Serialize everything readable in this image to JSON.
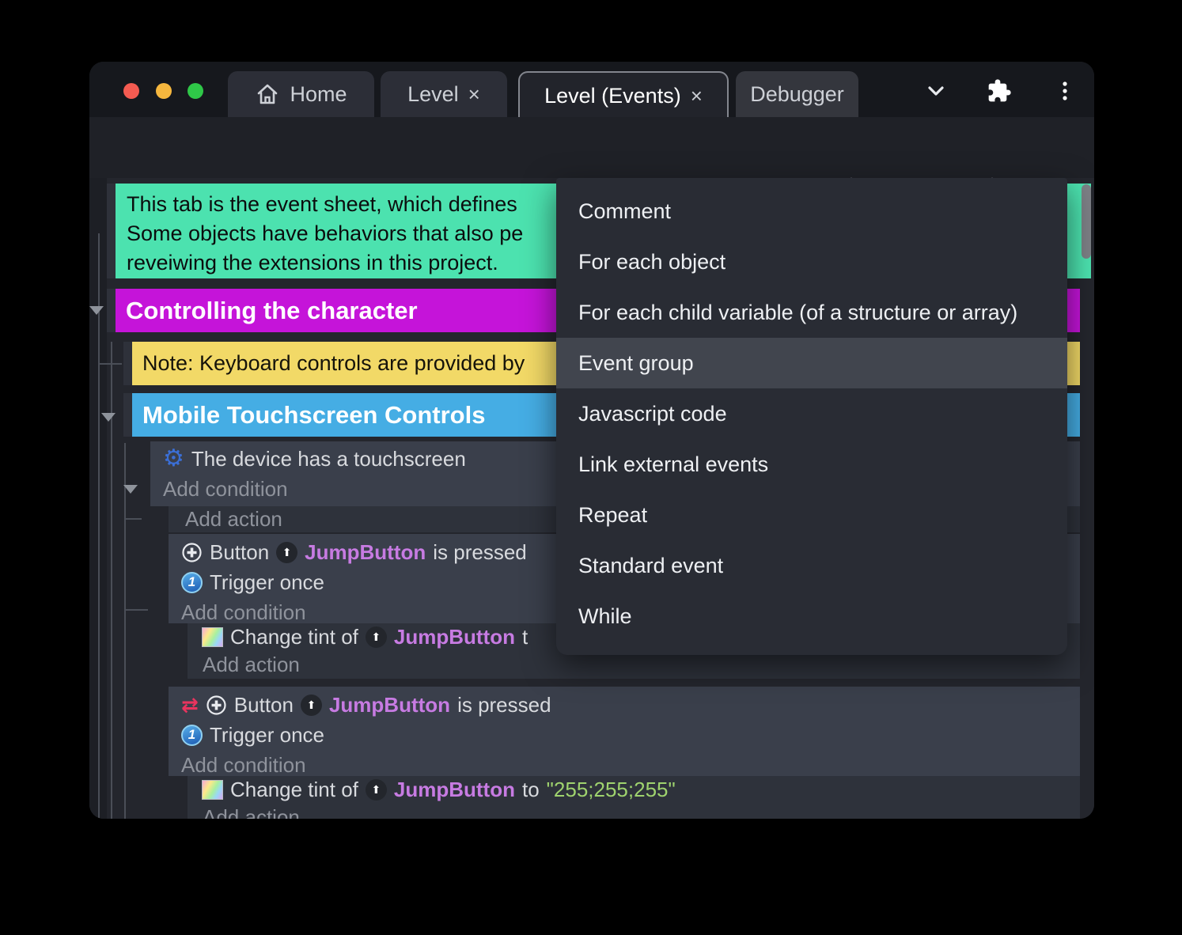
{
  "window": {
    "tab_home": "Home",
    "tab_level": "Level",
    "tab_level_events": "Level (Events)",
    "tab_debugger": "Debugger",
    "close_glyph": "×"
  },
  "sheet": {
    "comment_line1": "This tab is the event sheet, which defines",
    "comment_line2": "Some objects have behaviors that also pe",
    "comment_line3": "reveiwing the extensions in this project.",
    "group_controlling": "Controlling the character",
    "note": "Note: Keyboard controls are provided by",
    "group_mobile": "Mobile Touchscreen Controls",
    "cond_touchscreen": "The device has a touchscreen",
    "add_condition": "Add condition",
    "add_action": "Add action",
    "button_obj": "Button",
    "jumpbutton": "JumpButton",
    "is_pressed": "is pressed",
    "trigger_once": "Trigger once",
    "change_tint_of": "Change tint of",
    "to_word": "to",
    "to_cut": "t",
    "tint_value": "\"255;255;255\"",
    "up_arrow_glyph": "⬆",
    "gear_glyph": "⚙",
    "one_glyph": "1",
    "invert_glyph": "⇄"
  },
  "menu": {
    "items": [
      "Comment",
      "For each object",
      "For each child variable (of a structure or array)",
      "Event group",
      "Javascript code",
      "Link external events",
      "Repeat",
      "Standard event",
      "While"
    ],
    "highlighted_item": "Event group"
  },
  "colors": {
    "accent_purple": "#5b2ed3",
    "comment_teal": "#4ce2af",
    "group_magenta": "#c514d9",
    "note_yellow": "#f2d967",
    "group_blue": "#45ade4",
    "object_violet": "#c77be2",
    "string_green": "#9fd36e",
    "traffic_red": "#f45b51",
    "traffic_yellow": "#f6b73e",
    "traffic_green": "#2fc748",
    "menu_highlight": "#41454e"
  }
}
